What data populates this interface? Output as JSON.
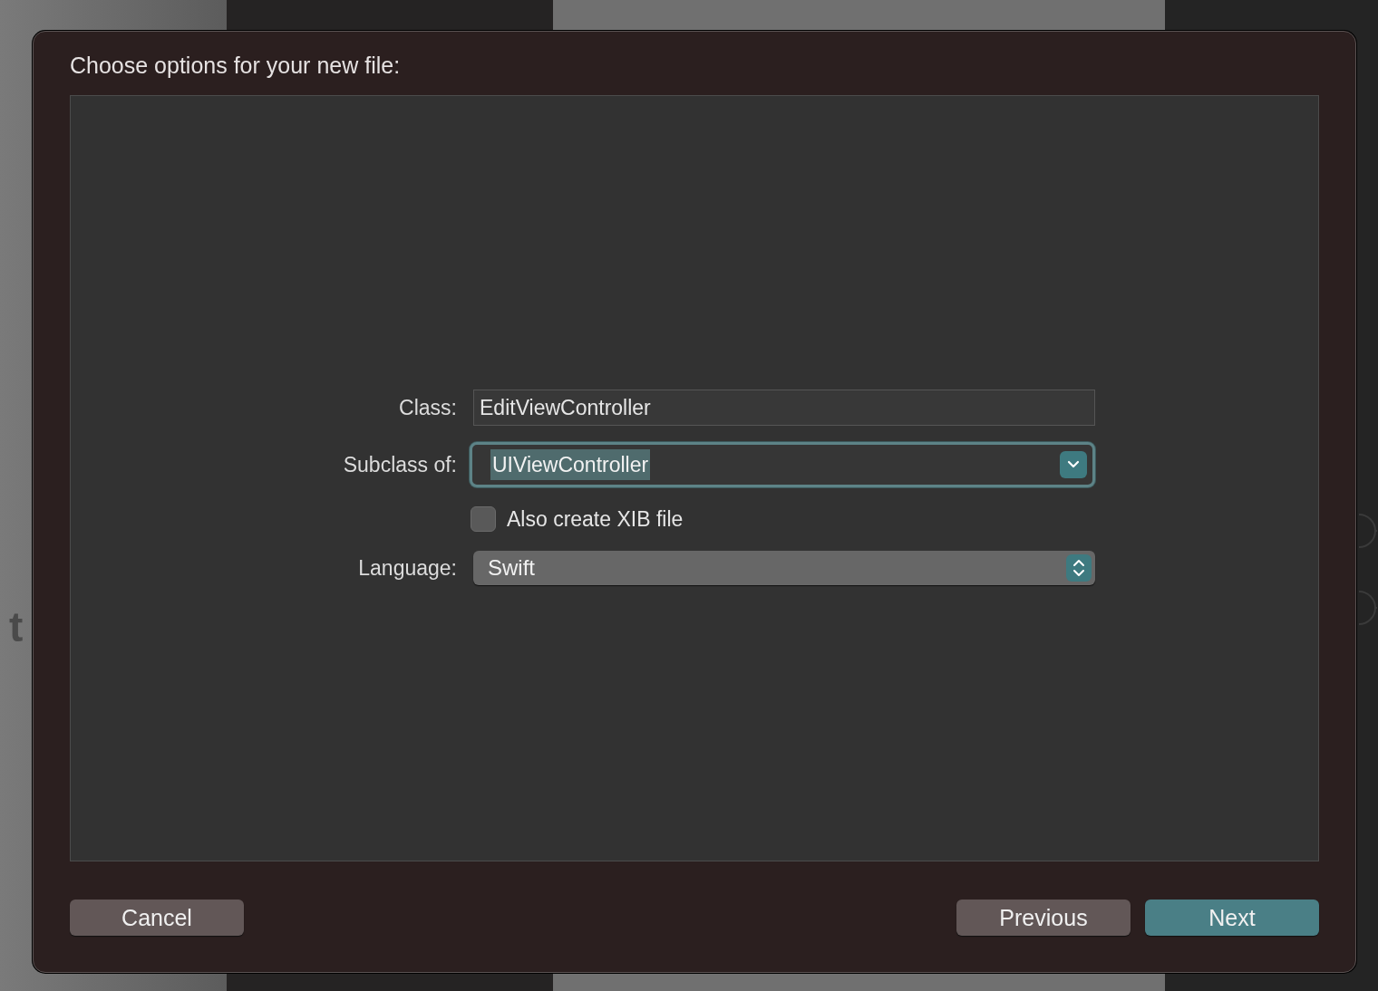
{
  "background": {
    "texts": [
      {
        "text": "t",
        "kind": "large"
      }
    ]
  },
  "dialog": {
    "title": "Choose options for your new file:",
    "fields": [
      {
        "kind": "text",
        "label": "Class:",
        "value": "EditViewController"
      },
      {
        "kind": "combo",
        "label": "Subclass of:",
        "value": "UIViewController",
        "focused": true
      },
      {
        "kind": "checkbox",
        "label": "Also create XIB file",
        "checked": false
      },
      {
        "kind": "popup",
        "label": "Language:",
        "value": "Swift"
      }
    ],
    "buttons": [
      {
        "label": "Cancel",
        "default": false
      },
      {
        "label": "Previous",
        "default": false
      },
      {
        "label": "Next",
        "default": true
      }
    ]
  }
}
